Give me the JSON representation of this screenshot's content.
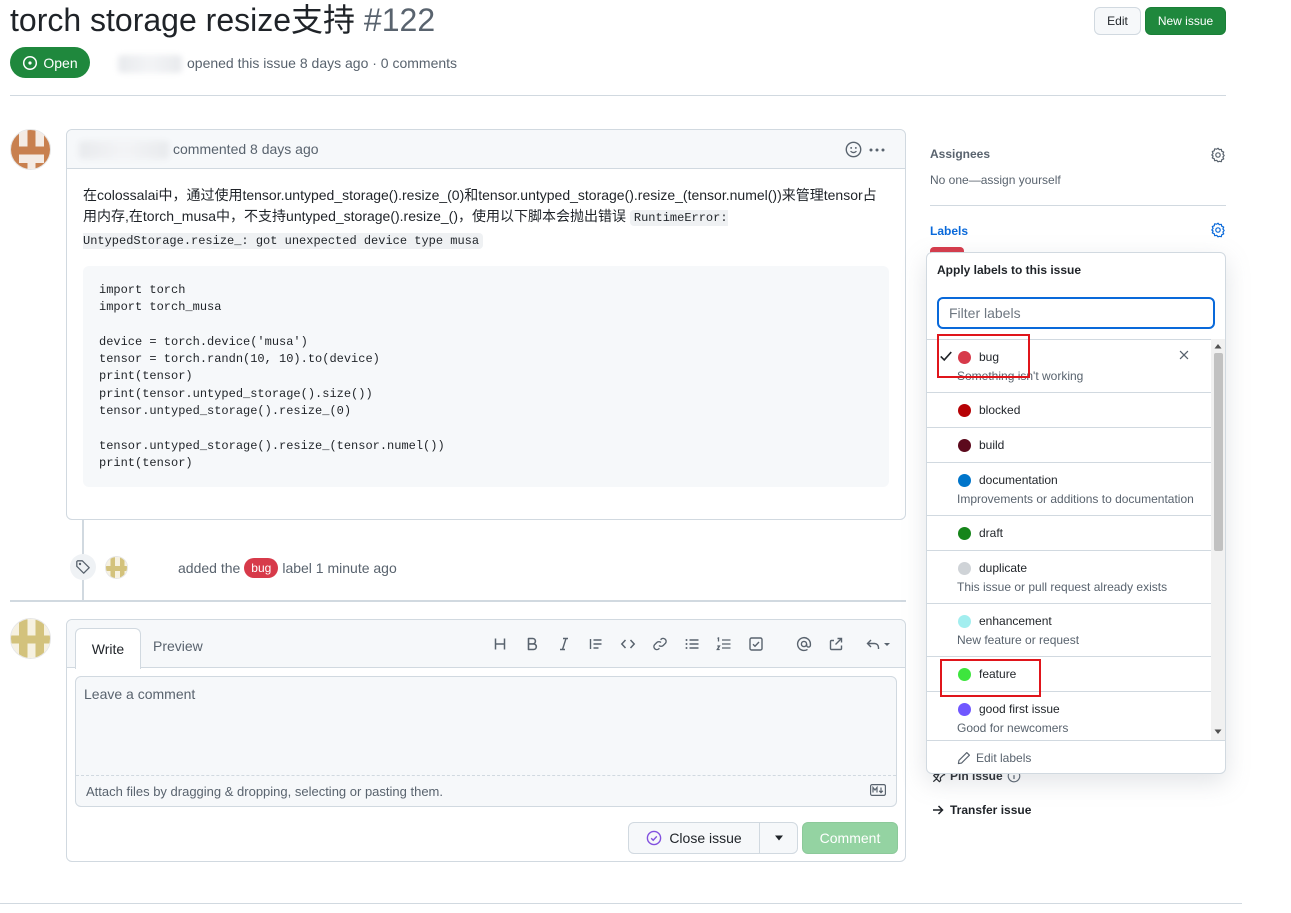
{
  "issue": {
    "title": "torch storage resize支持",
    "number": "#122",
    "state": "Open",
    "meta": "opened this issue 8 days ago · 0 comments"
  },
  "header_buttons": {
    "edit": "Edit",
    "new_issue": "New issue"
  },
  "comment": {
    "meta": "commented 8 days ago",
    "para_part1": "在colossalai中，通过使用tensor.untyped_storage().resize_(0)和tensor.untyped_storage().resize_(tensor.numel())来管理tensor占用内存,在torch_musa中，不支持untyped_storage().resize_()，使用以下脚本会抛出错误 ",
    "inline_code": "RuntimeError: UntypedStorage.resize_: got unexpected device type musa",
    "code": "import torch\nimport torch_musa\n\ndevice = torch.device('musa')\ntensor = torch.randn(10, 10).to(device)\nprint(tensor)\nprint(tensor.untyped_storage().size())\ntensor.untyped_storage().resize_(0)\n\ntensor.untyped_storage().resize_(tensor.numel())\nprint(tensor)"
  },
  "event": {
    "prefix": "added the",
    "label": "bug",
    "suffix": "label 1 minute ago"
  },
  "composer": {
    "tab_write": "Write",
    "tab_preview": "Preview",
    "placeholder": "Leave a comment",
    "attach_hint": "Attach files by dragging & dropping, selecting or pasting them.",
    "close_issue": "Close issue",
    "submit": "Comment"
  },
  "sidebar": {
    "assignees_heading": "Assignees",
    "assignees_value": "No one—assign yourself",
    "labels_heading": "Labels",
    "pin_issue": "Pin issue",
    "transfer_issue": "Transfer issue"
  },
  "label_picker": {
    "title": "Apply labels to this issue",
    "filter_placeholder": "Filter labels",
    "edit_labels": "Edit labels",
    "items": [
      {
        "name": "bug",
        "description": "Something isn't working",
        "color": "#d73a4a",
        "selected": true
      },
      {
        "name": "blocked",
        "description": "",
        "color": "#b60205",
        "selected": false
      },
      {
        "name": "build",
        "description": "",
        "color": "#5c0a1d",
        "selected": false
      },
      {
        "name": "documentation",
        "description": "Improvements or additions to documentation",
        "color": "#0075ca",
        "selected": false
      },
      {
        "name": "draft",
        "description": "",
        "color": "#16851a",
        "selected": false
      },
      {
        "name": "duplicate",
        "description": "This issue or pull request already exists",
        "color": "#cfd3d7",
        "selected": false
      },
      {
        "name": "enhancement",
        "description": "New feature or request",
        "color": "#a2eeef",
        "selected": false
      },
      {
        "name": "feature",
        "description": "",
        "color": "#3ee53e",
        "selected": false
      },
      {
        "name": "good first issue",
        "description": "Good for newcomers",
        "color": "#7057ff",
        "selected": false
      }
    ]
  },
  "colors": {
    "open_green": "#1f883d",
    "link_blue": "#0969da",
    "bug_red": "#d73a4a",
    "annotation_red": "#e0151b"
  }
}
